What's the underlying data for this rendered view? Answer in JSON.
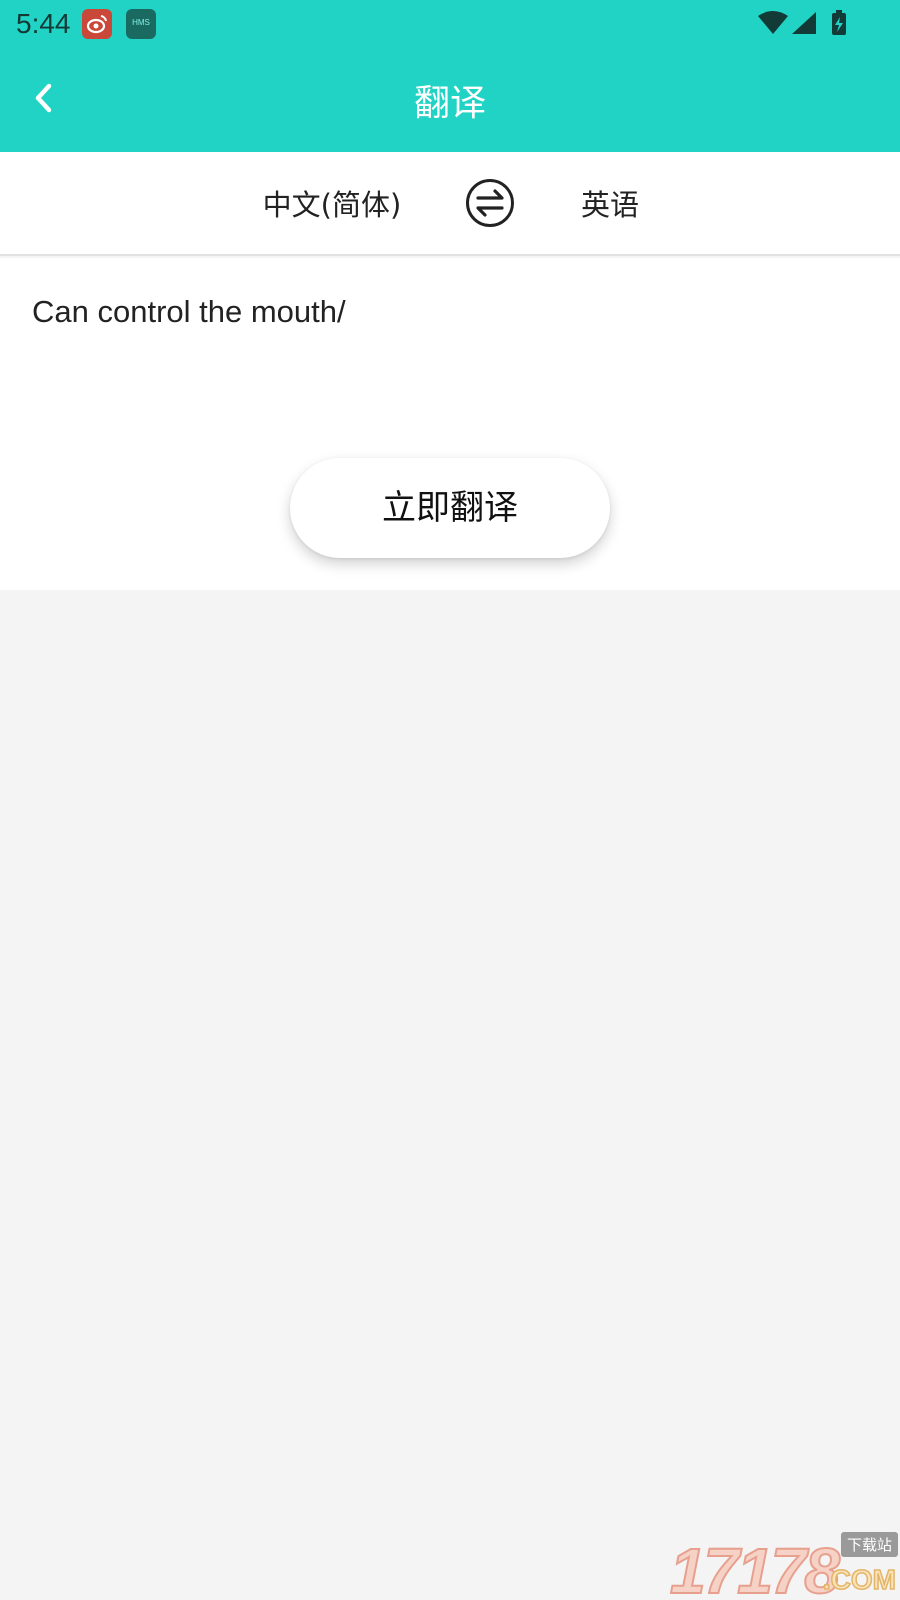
{
  "status_bar": {
    "time": "5:44",
    "notification_icons": [
      "weibo-icon",
      "hms-icon"
    ],
    "hms_label": "HMS",
    "system_icons": [
      "wifi-icon",
      "signal-icon",
      "battery-charging-icon"
    ]
  },
  "header": {
    "title": "翻译",
    "back_icon": "chevron-left-icon"
  },
  "languages": {
    "source": "中文(简体)",
    "target": "英语",
    "swap_icon": "swap-arrows-icon"
  },
  "input": {
    "value": "Can control the mouth/"
  },
  "actions": {
    "translate_label": "立即翻译"
  },
  "watermark": {
    "digits": "17178",
    "tag": "下载站",
    "suffix": ".COM"
  },
  "colors": {
    "accent": "#20d3c4",
    "background": "#f4f4f4",
    "surface": "#ffffff"
  }
}
